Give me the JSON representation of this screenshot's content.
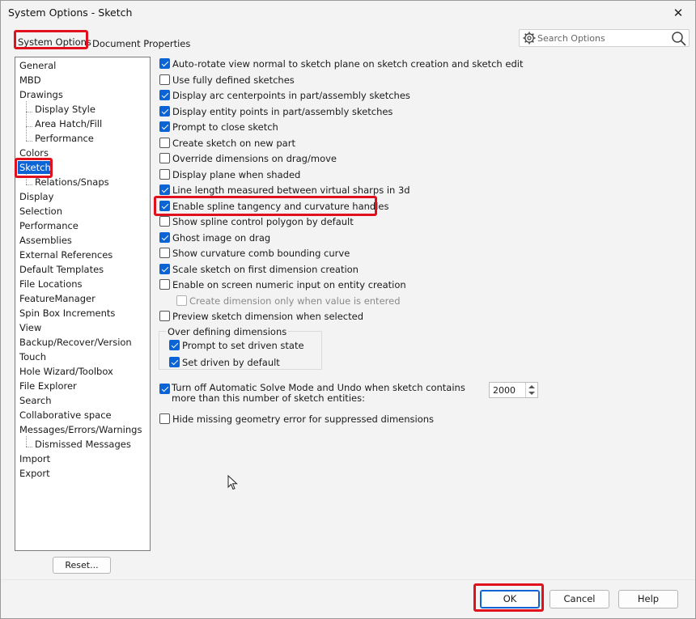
{
  "window": {
    "title": "System Options - Sketch",
    "close_glyph": "✕"
  },
  "tabs": [
    {
      "label": "System Options",
      "active": true
    },
    {
      "label": "Document Properties",
      "active": false
    }
  ],
  "search": {
    "placeholder": "Search Options"
  },
  "tree": {
    "items": [
      {
        "label": "General",
        "level": 0
      },
      {
        "label": "MBD",
        "level": 0
      },
      {
        "label": "Drawings",
        "level": 0
      },
      {
        "label": "Display Style",
        "level": 1
      },
      {
        "label": "Area Hatch/Fill",
        "level": 1
      },
      {
        "label": "Performance",
        "level": 1
      },
      {
        "label": "Colors",
        "level": 0
      },
      {
        "label": "Sketch",
        "level": 0,
        "selected": true
      },
      {
        "label": "Relations/Snaps",
        "level": 1
      },
      {
        "label": "Display",
        "level": 0
      },
      {
        "label": "Selection",
        "level": 0
      },
      {
        "label": "Performance",
        "level": 0
      },
      {
        "label": "Assemblies",
        "level": 0
      },
      {
        "label": "External References",
        "level": 0
      },
      {
        "label": "Default Templates",
        "level": 0
      },
      {
        "label": "File Locations",
        "level": 0
      },
      {
        "label": "FeatureManager",
        "level": 0
      },
      {
        "label": "Spin Box Increments",
        "level": 0
      },
      {
        "label": "View",
        "level": 0
      },
      {
        "label": "Backup/Recover/Version",
        "level": 0
      },
      {
        "label": "Touch",
        "level": 0
      },
      {
        "label": "Hole Wizard/Toolbox",
        "level": 0
      },
      {
        "label": "File Explorer",
        "level": 0
      },
      {
        "label": "Search",
        "level": 0
      },
      {
        "label": "Collaborative space",
        "level": 0
      },
      {
        "label": "Messages/Errors/Warnings",
        "level": 0
      },
      {
        "label": "Dismissed Messages",
        "level": 1
      },
      {
        "label": "Import",
        "level": 0
      },
      {
        "label": "Export",
        "level": 0
      }
    ],
    "reset_label": "Reset..."
  },
  "options": [
    {
      "label": "Auto-rotate view normal to sketch plane on sketch creation and sketch edit",
      "checked": true
    },
    {
      "label": "Use fully defined sketches",
      "checked": false
    },
    {
      "label": "Display arc centerpoints in part/assembly sketches",
      "checked": true
    },
    {
      "label": "Display entity points in part/assembly sketches",
      "checked": true
    },
    {
      "label": "Prompt to close sketch",
      "checked": true
    },
    {
      "label": "Create sketch on new part",
      "checked": false
    },
    {
      "label": "Override dimensions on drag/move",
      "checked": false
    },
    {
      "label": "Display plane when shaded",
      "checked": false
    },
    {
      "label": "Line length measured between virtual sharps in 3d",
      "checked": true
    },
    {
      "label": "Enable spline tangency and curvature handles",
      "checked": true
    },
    {
      "label": "Show spline control polygon by default",
      "checked": false
    },
    {
      "label": "Ghost image on drag",
      "checked": true
    },
    {
      "label": "Show curvature comb bounding curve",
      "checked": false
    },
    {
      "label": "Scale sketch on first dimension creation",
      "checked": true
    },
    {
      "label": "Enable on screen numeric input on entity creation",
      "checked": false
    },
    {
      "label": "Create dimension only when value is entered",
      "checked": false,
      "disabled": true
    },
    {
      "label": "Preview sketch dimension when selected",
      "checked": false
    }
  ],
  "overdefining": {
    "title": "Over defining dimensions",
    "options": [
      {
        "label": "Prompt to set driven state",
        "checked": true
      },
      {
        "label": "Set driven by default",
        "checked": true
      }
    ]
  },
  "solve_mode": {
    "label": "Turn off Automatic Solve Mode and Undo when sketch contains more than this number of sketch entities:",
    "checked": true,
    "value": "2000"
  },
  "hide_missing": {
    "label": "Hide missing geometry error for suppressed dimensions",
    "checked": false
  },
  "footer": {
    "ok": "OK",
    "cancel": "Cancel",
    "help": "Help"
  },
  "highlight_color": "#e0101c",
  "accent_color": "#0a64d6"
}
